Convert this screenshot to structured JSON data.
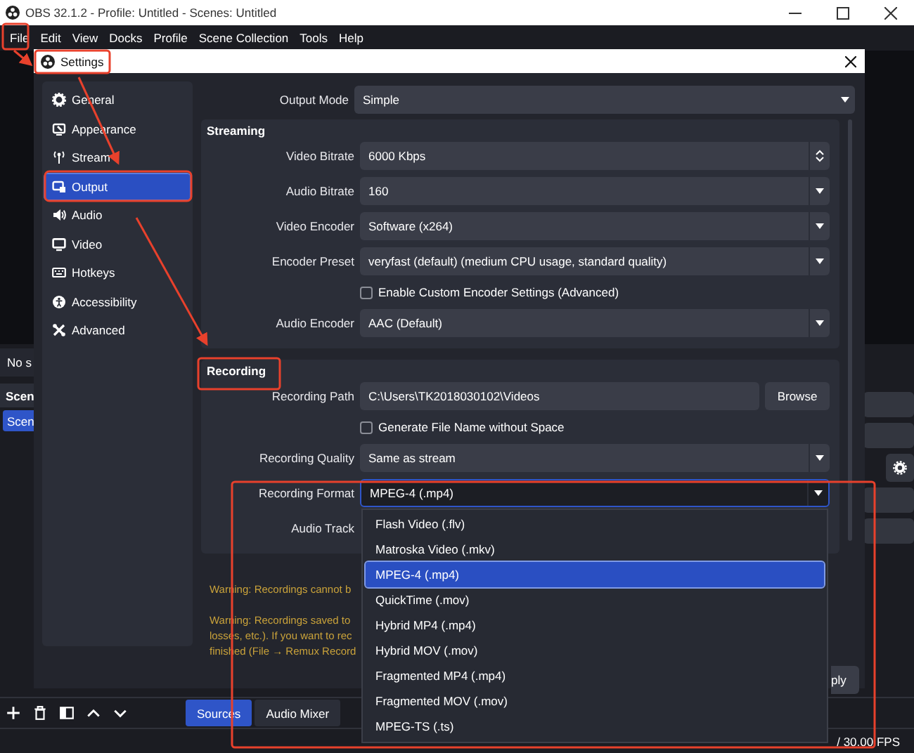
{
  "window": {
    "title": "OBS 32.1.2 - Profile: Untitled - Scenes: Untitled"
  },
  "menu": [
    "File",
    "Edit",
    "View",
    "Docks",
    "Profile",
    "Scene Collection",
    "Tools",
    "Help"
  ],
  "main": {
    "source_status": "No s",
    "scenes_header": "Scen",
    "scenes": [
      {
        "label": "Scen",
        "selected": true
      }
    ],
    "dock_tabs": [
      {
        "label": "Sources",
        "selected": true
      },
      {
        "label": "Audio Mixer",
        "selected": false
      }
    ],
    "status_fps": "/ 30.00 FPS"
  },
  "settings": {
    "title": "Settings",
    "sidebar": [
      {
        "kind": "general",
        "label": "General",
        "selected": false
      },
      {
        "kind": "appearance",
        "label": "Appearance",
        "selected": false
      },
      {
        "kind": "stream",
        "label": "Stream",
        "selected": false
      },
      {
        "kind": "output",
        "label": "Output",
        "selected": true
      },
      {
        "kind": "audio",
        "label": "Audio",
        "selected": false
      },
      {
        "kind": "video",
        "label": "Video",
        "selected": false
      },
      {
        "kind": "hotkeys",
        "label": "Hotkeys",
        "selected": false
      },
      {
        "kind": "accessibility",
        "label": "Accessibility",
        "selected": false
      },
      {
        "kind": "advanced",
        "label": "Advanced",
        "selected": false
      }
    ],
    "output_mode": {
      "label": "Output Mode",
      "value": "Simple"
    },
    "sections": [
      {
        "title": "Streaming",
        "rows": [
          {
            "kind": "spin",
            "label": "Video Bitrate",
            "value": "6000 Kbps"
          },
          {
            "kind": "select",
            "label": "Audio Bitrate",
            "value": "160"
          },
          {
            "kind": "select",
            "label": "Video Encoder",
            "value": "Software (x264)"
          },
          {
            "kind": "select",
            "label": "Encoder Preset",
            "value": "veryfast (default) (medium CPU usage, standard quality)"
          },
          {
            "kind": "checkbox",
            "label": "Enable Custom Encoder Settings (Advanced)",
            "checked": false
          },
          {
            "kind": "select",
            "label": "Audio Encoder",
            "value": "AAC (Default)"
          }
        ]
      },
      {
        "title": "Recording",
        "rows": [
          {
            "kind": "path",
            "label": "Recording Path",
            "value": "C:\\Users\\TK2018030102\\Videos",
            "button": "Browse"
          },
          {
            "kind": "checkbox",
            "label": "Generate File Name without Space",
            "checked": false
          },
          {
            "kind": "select",
            "label": "Recording Quality",
            "value": "Same as stream"
          },
          {
            "kind": "select",
            "label": "Recording Format",
            "value": "MPEG-4 (.mp4)",
            "expanded": true,
            "options": [
              {
                "label": "Flash Video (.flv)",
                "selected": false
              },
              {
                "label": "Matroska Video (.mkv)",
                "selected": false
              },
              {
                "label": "MPEG-4 (.mp4)",
                "selected": true
              },
              {
                "label": "QuickTime (.mov)",
                "selected": false
              },
              {
                "label": "Hybrid MP4 (.mp4)",
                "selected": false
              },
              {
                "label": "Hybrid MOV (.mov)",
                "selected": false
              },
              {
                "label": "Fragmented MP4 (.mp4)",
                "selected": false
              },
              {
                "label": "Fragmented MOV (.mov)",
                "selected": false
              },
              {
                "label": "MPEG-TS (.ts)",
                "selected": false
              }
            ]
          },
          {
            "kind": "label_only",
            "label": "Audio Track"
          }
        ]
      }
    ],
    "warnings": [
      {
        "lines": [
          "Warning: Recordings cannot b"
        ]
      },
      {
        "lines": [
          "Warning: Recordings saved to",
          "losses, etc.). If you want to rec",
          "finished (File → Remux Record"
        ]
      }
    ],
    "apply_button": "ply"
  }
}
